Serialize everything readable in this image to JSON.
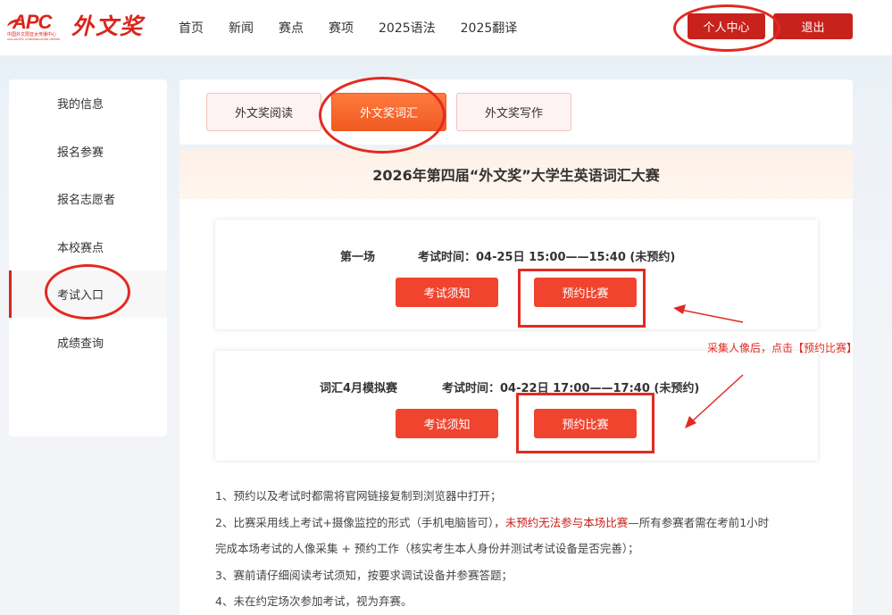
{
  "header": {
    "logo_apc": "APC",
    "logo_apc_sub": "中国外文局亚太传播中心",
    "logo_apc_sub2": "ASIA-PACIFIC COMMUNICATION CENTER",
    "logo_brand": "外文奖",
    "nav": [
      "首页",
      "新闻",
      "赛点",
      "赛项",
      "2025语法",
      "2025翻译"
    ],
    "personal_center": "个人中心",
    "logout": "退出"
  },
  "sidebar": {
    "items": [
      "我的信息",
      "报名参赛",
      "报名志愿者",
      "本校赛点",
      "考试入口",
      "成绩查询"
    ],
    "active_index": 4
  },
  "tabs": {
    "items": [
      "外文奖阅读",
      "外文奖词汇",
      "外文奖写作"
    ],
    "active_index": 1
  },
  "main": {
    "title": "2026年第四届“外文奖”大学生英语词汇大赛",
    "sessions": [
      {
        "name": "第一场",
        "time": "考试时间：04-25日 15:00——15:40 (未预约)",
        "notice_button": "考试须知",
        "reserve_button": "预约比赛"
      },
      {
        "name": "词汇4月模拟赛",
        "time": "考试时间：04-22日 17:00——17:40 (未预约)",
        "notice_button": "考试须知",
        "reserve_button": "预约比赛"
      }
    ],
    "notes": {
      "n1": "1、预约以及考试时都需将官网链接复制到浏览器中打开；",
      "n2_a": "2、比赛采用线上考试+摄像监控的形式（手机电脑皆可），",
      "n2_hl": "未预约无法参与本场比赛",
      "n2_b": "—所有参赛者需在考前1小时",
      "n2_c": "完成本场考试的人像采集 + 预约工作（核实考生本人身份并测试考试设备是否完善）；",
      "n3": "3、赛前请仔细阅读考试须知，按要求调试设备并参赛答题；",
      "n4": "4、未在约定场次参加考试，视为弃赛。"
    }
  },
  "annotation": {
    "text": "采集人像后，点击【预约比赛】",
    "color": "#e22a22"
  },
  "colors": {
    "brand_red": "#c8221c",
    "button_red": "#f0442e",
    "tab_active": "#f05a22"
  }
}
